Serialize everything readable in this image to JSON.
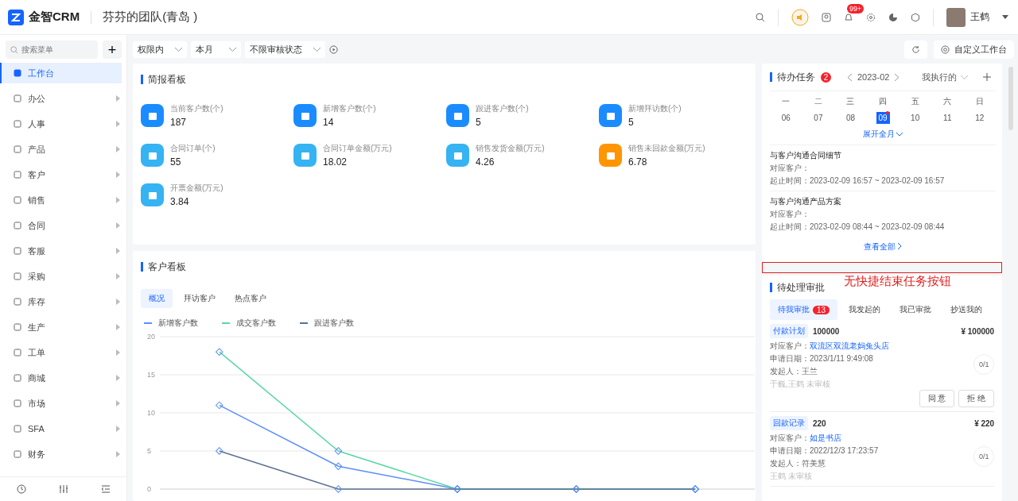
{
  "header": {
    "logo_text": "金智CRM",
    "team": "芬芬的团队(青岛 )",
    "notification_badge": "99+",
    "user_name": "王鹤"
  },
  "sidebar": {
    "search_placeholder": "搜索菜单",
    "add_symbol": "+",
    "items": [
      {
        "label": "工作台",
        "selected": true,
        "has_children": false
      },
      {
        "label": "办公",
        "selected": false,
        "has_children": true
      },
      {
        "label": "人事",
        "selected": false,
        "has_children": true
      },
      {
        "label": "产品",
        "selected": false,
        "has_children": true
      },
      {
        "label": "客户",
        "selected": false,
        "has_children": true
      },
      {
        "label": "销售",
        "selected": false,
        "has_children": true
      },
      {
        "label": "合同",
        "selected": false,
        "has_children": true
      },
      {
        "label": "客服",
        "selected": false,
        "has_children": true
      },
      {
        "label": "采购",
        "selected": false,
        "has_children": true
      },
      {
        "label": "库存",
        "selected": false,
        "has_children": true
      },
      {
        "label": "生产",
        "selected": false,
        "has_children": true
      },
      {
        "label": "工单",
        "selected": false,
        "has_children": true
      },
      {
        "label": "商城",
        "selected": false,
        "has_children": true
      },
      {
        "label": "市场",
        "selected": false,
        "has_children": true
      },
      {
        "label": "SFA",
        "selected": false,
        "has_children": true
      },
      {
        "label": "财务",
        "selected": false,
        "has_children": true
      }
    ]
  },
  "toolbar": {
    "filters": [
      "权限内",
      "本月",
      "不限审核状态"
    ],
    "customize_button": "自定义工作台"
  },
  "briefing": {
    "title": "简报看板",
    "stats": [
      {
        "label": "当前客户数(个)",
        "value": "187",
        "color": "#1a8cff"
      },
      {
        "label": "新增客户数(个)",
        "value": "14",
        "color": "#1a8cff"
      },
      {
        "label": "跟进客户数(个)",
        "value": "5",
        "color": "#1a8cff"
      },
      {
        "label": "新增拜访数(个)",
        "value": "5",
        "color": "#1a8cff"
      },
      {
        "label": "合同订单(个)",
        "value": "55",
        "color": "#36b3f2"
      },
      {
        "label": "合同订单金额(万元)",
        "value": "18.02",
        "color": "#36b3f2"
      },
      {
        "label": "销售发货金额(万元)",
        "value": "4.26",
        "color": "#36b3f2"
      },
      {
        "label": "销售未回款金额(万元)",
        "value": "6.78",
        "color": "#ff9500"
      },
      {
        "label": "开票金额(万元)",
        "value": "3.84",
        "color": "#36b3f2"
      }
    ]
  },
  "customer_board": {
    "title": "客户看板",
    "tabs": [
      {
        "label": "概况",
        "selected": true
      },
      {
        "label": "拜访客户",
        "selected": false
      },
      {
        "label": "热点客户",
        "selected": false
      }
    ],
    "chart_data": {
      "type": "line",
      "ylim": [
        0,
        20
      ],
      "yticks": [
        0,
        5,
        10,
        15,
        20
      ],
      "grid": true,
      "series": [
        {
          "name": "新增客户数",
          "color": "#5b8ff9",
          "marker": "diamond",
          "values": [
            11,
            3,
            0,
            0,
            0
          ]
        },
        {
          "name": "成交客户数",
          "color": "#5ad8a6",
          "marker": "diamond",
          "values": [
            18,
            5,
            0,
            0,
            0
          ]
        },
        {
          "name": "跟进客户数",
          "color": "#5d7092",
          "marker": "diamond",
          "values": [
            5,
            0,
            0,
            0,
            0
          ]
        }
      ]
    }
  },
  "tasks": {
    "title": "待办任务",
    "count": "2",
    "month": "2023-02",
    "filter": "我执行的",
    "weekdays": [
      "一",
      "二",
      "三",
      "四",
      "五",
      "六",
      "日"
    ],
    "days": [
      {
        "date": "06",
        "selected": false,
        "has_task": false
      },
      {
        "date": "07",
        "selected": false,
        "has_task": false
      },
      {
        "date": "08",
        "selected": false,
        "has_task": false
      },
      {
        "date": "09",
        "selected": true,
        "has_task": true
      },
      {
        "date": "10",
        "selected": false,
        "has_task": false
      },
      {
        "date": "11",
        "selected": false,
        "has_task": false
      },
      {
        "date": "12",
        "selected": false,
        "has_task": false
      }
    ],
    "expand_link": "展开全月",
    "items": [
      {
        "title": "与客户沟通合同细节",
        "customer": "对应客户：",
        "time": "起止时间：2023-02-09 16:57 ~ 2023-02-09 16:57"
      },
      {
        "title": "与客户沟通产品方案",
        "customer": "对应客户：",
        "time": "起止时间：2023-02-09 08:44 ~ 2023-02-09 08:44"
      }
    ],
    "view_all": "查看全部"
  },
  "annotation": {
    "text": "无快捷结束任务按钮"
  },
  "approvals": {
    "title": "待处理审批",
    "tabs": [
      {
        "label": "待我审批",
        "badge": "13",
        "selected": true
      },
      {
        "label": "我发起的",
        "selected": false
      },
      {
        "label": "我已审批",
        "selected": false
      },
      {
        "label": "抄送我的",
        "selected": false
      }
    ],
    "items": [
      {
        "tag": "付款计划",
        "title": "100000",
        "amount": "¥ 100000",
        "customer_label": "对应客户：",
        "customer": "双流区双流老妈兔头店",
        "date": "申请日期：2023/1/11 9:49:08",
        "initiator": "发起人：王兰",
        "status": "于巍,王鹤 未审核",
        "progress": "0/1",
        "actions": [
          "同 意",
          "拒 绝"
        ]
      },
      {
        "tag": "回款记录",
        "title": "220",
        "amount": "¥ 220",
        "customer_label": "对应客户：",
        "customer": "如是书店",
        "date": "申请日期：2022/12/3 17:23:57",
        "initiator": "发起人：符美慧",
        "status": "王鹤 未审核",
        "progress": "0/1"
      }
    ]
  }
}
